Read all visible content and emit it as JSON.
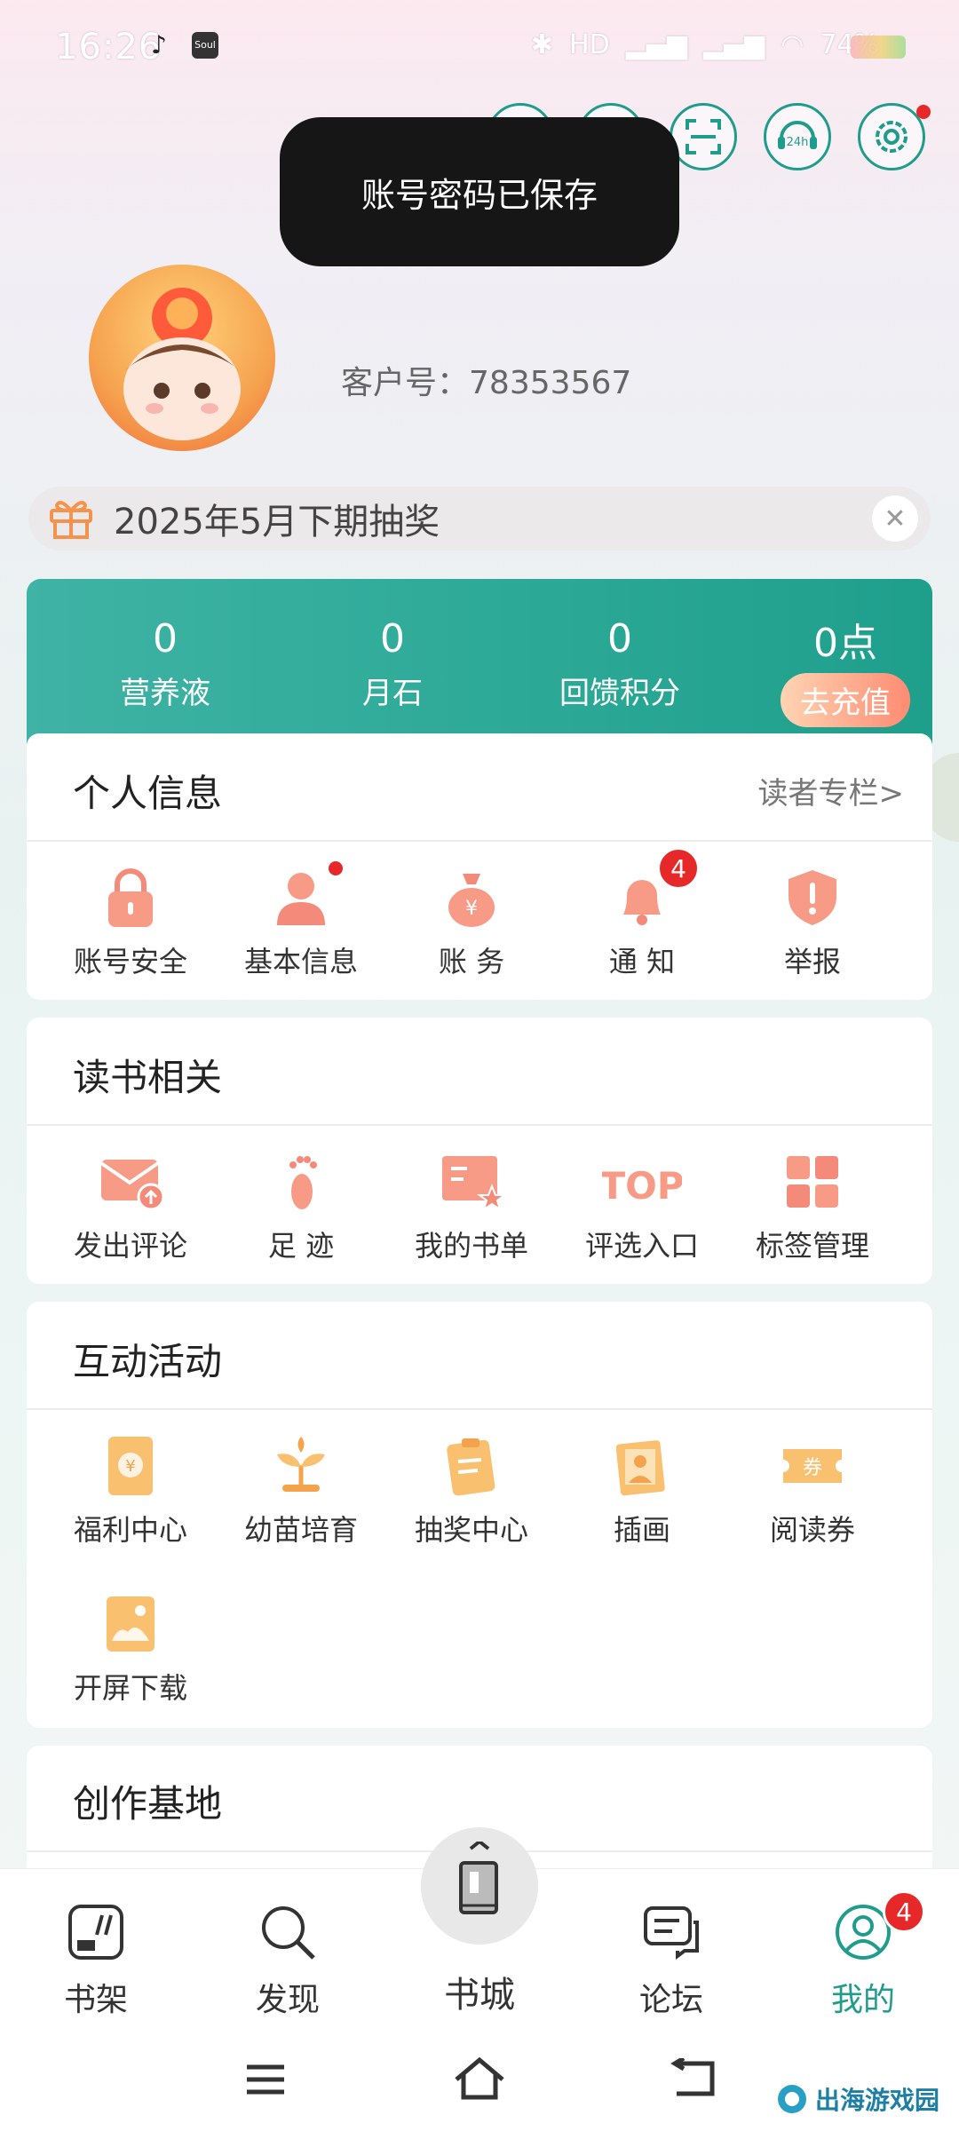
{
  "status_bar": {
    "time": "16:26",
    "battery": "74%",
    "app2_label": "Soul"
  },
  "toast": {
    "message": "账号密码已保存"
  },
  "profile": {
    "customer_label": "客户号：",
    "customer_id": "78353567"
  },
  "lottery": {
    "label": "2025年5月下期抽奖"
  },
  "stats": {
    "items": [
      {
        "value": "0",
        "label": "营养液"
      },
      {
        "value": "0",
        "label": "月石"
      },
      {
        "value": "0",
        "label": "回馈积分"
      },
      {
        "value": "0点",
        "label": "去充值"
      }
    ]
  },
  "personal": {
    "title": "个人信息",
    "link": "读者专栏>",
    "items": [
      {
        "label": "账号安全",
        "icon": "lock-icon"
      },
      {
        "label": "基本信息",
        "icon": "user-icon"
      },
      {
        "label": "账  务",
        "icon": "money-bag-icon"
      },
      {
        "label": "通  知",
        "icon": "bell-icon",
        "badge": "4"
      },
      {
        "label": "举报",
        "icon": "warning-shield-icon"
      }
    ]
  },
  "reading": {
    "title": "读书相关",
    "items": [
      {
        "label": "发出评论",
        "icon": "envelope-icon"
      },
      {
        "label": "足 迹",
        "icon": "footprint-icon"
      },
      {
        "label": "我的书单",
        "icon": "booklist-icon"
      },
      {
        "label": "评选入口",
        "icon": "top-icon",
        "icon_text": "TOP"
      },
      {
        "label": "标签管理",
        "icon": "grid-icon"
      }
    ]
  },
  "activity": {
    "title": "互动活动",
    "items": [
      {
        "label": "福利中心",
        "icon": "red-envelope-icon"
      },
      {
        "label": "幼苗培育",
        "icon": "sprout-icon"
      },
      {
        "label": "抽奖中心",
        "icon": "clipboard-icon"
      },
      {
        "label": "插画",
        "icon": "illustration-icon"
      },
      {
        "label": "阅读券",
        "icon": "coupon-icon",
        "icon_text": "券"
      },
      {
        "label": "开屏下载",
        "icon": "image-icon"
      }
    ]
  },
  "creation": {
    "title": "创作基地"
  },
  "bottom_nav": {
    "items": [
      {
        "label": "书架",
        "icon": "bookshelf-icon"
      },
      {
        "label": "发现",
        "icon": "search-icon"
      },
      {
        "label": "书城",
        "icon": "book-city-icon"
      },
      {
        "label": "论坛",
        "icon": "chat-icon"
      },
      {
        "label": "我的",
        "icon": "profile-icon",
        "badge": "4",
        "active": true
      }
    ]
  },
  "watermark": "出海游戏园",
  "colors": {
    "accent": "#1f9c8c",
    "badge": "#e62828",
    "icon_coral": "#f48a7a",
    "icon_orange": "#f5a24c"
  }
}
